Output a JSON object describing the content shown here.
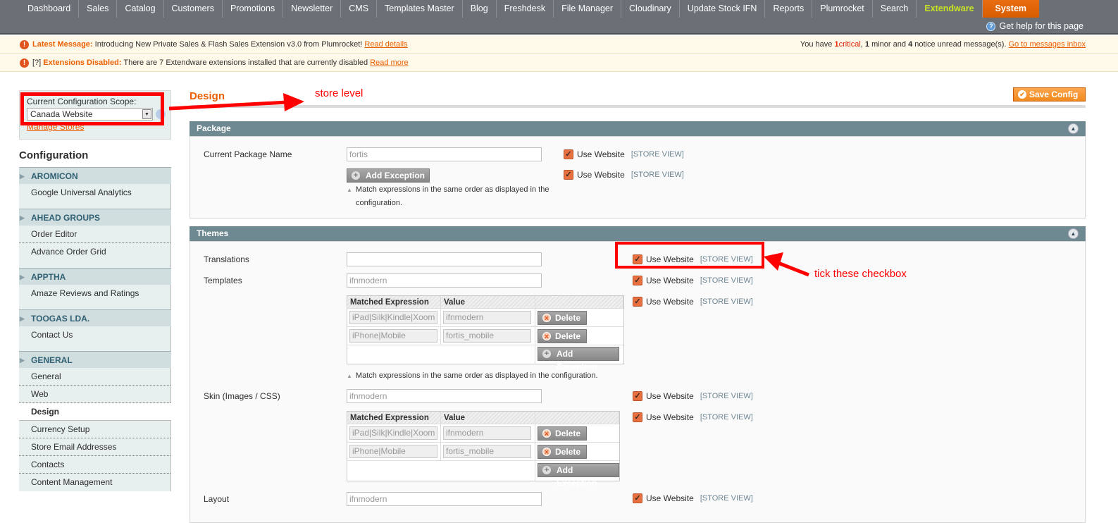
{
  "nav": {
    "items": [
      "Dashboard",
      "Sales",
      "Catalog",
      "Customers",
      "Promotions",
      "Newsletter",
      "CMS",
      "Templates Master",
      "Blog",
      "Freshdesk",
      "File Manager",
      "Cloudinary",
      "Update Stock IFN",
      "Reports",
      "Plumrocket",
      "Search",
      "Extendware",
      "System"
    ],
    "highlight_item": "Extendware",
    "active_item": "System",
    "help_text": "Get help for this page"
  },
  "messages": {
    "latest_label": "Latest Message:",
    "latest_text": "Introducing New Private Sales & Flash Sales Extension v3.0 from Plumrocket!",
    "latest_link": "Read details",
    "summary_prefix": "You have",
    "critical_count": "1",
    "critical_label": "critical",
    "minor_count": "1",
    "minor_label": "minor and",
    "notice_count": "4",
    "notice_label": "notice unread message(s).",
    "inbox_link": "Go to messages inbox",
    "ext_prefix": "[?]",
    "ext_label": "Extensions Disabled:",
    "ext_text": "There are 7 Extendware extensions installed that are currently disabled",
    "ext_link": "Read more"
  },
  "scope": {
    "label": "Current Configuration Scope:",
    "value": "Canada Website",
    "manage_link": "Manage Stores"
  },
  "sidebar": {
    "title": "Configuration",
    "sections": [
      {
        "title": "AROMICON",
        "items": [
          "Google Universal Analytics"
        ]
      },
      {
        "title": "AHEAD GROUPS",
        "items": [
          "Order Editor",
          "Advance Order Grid"
        ]
      },
      {
        "title": "APPTHA",
        "items": [
          "Amaze Reviews and Ratings"
        ]
      },
      {
        "title": "TOOGAS LDA.",
        "items": [
          "Contact Us"
        ]
      },
      {
        "title": "GENERAL",
        "items": [
          "General",
          "Web",
          "Design",
          "Currency Setup",
          "Store Email Addresses",
          "Contacts",
          "Content Management"
        ],
        "active": "Design"
      }
    ]
  },
  "page": {
    "title": "Design",
    "save_label": "Save Config"
  },
  "annotations": {
    "store_level": "store level",
    "tick": "tick these checkbox"
  },
  "package": {
    "title": "Package",
    "current_label": "Current Package Name",
    "current_value": "fortis",
    "add_exception": "Add Exception",
    "note": "Match expressions in the same order as displayed in the",
    "note2": "configuration."
  },
  "common": {
    "use_website": "Use Website",
    "store_view": "[STORE VIEW]",
    "delete": "Delete",
    "add_exception": "Add Exception",
    "col_expr": "Matched Expression",
    "col_value": "Value",
    "note": "Match expressions in the same order as displayed in the configuration."
  },
  "themes": {
    "title": "Themes",
    "translations_label": "Translations",
    "translations_value": "",
    "templates_label": "Templates",
    "templates_value": "ifnmodern",
    "templates_exceptions": [
      {
        "expr": "iPad|Silk|Kindle|Xoom",
        "value": "ifnmodern"
      },
      {
        "expr": "iPhone|Mobile",
        "value": "fortis_mobile"
      }
    ],
    "skin_label": "Skin (Images / CSS)",
    "skin_value": "ifnmodern",
    "skin_exceptions": [
      {
        "expr": "iPad|Silk|Kindle|Xoom",
        "value": "ifnmodern"
      },
      {
        "expr": "iPhone|Mobile",
        "value": "fortis_mobile"
      }
    ],
    "layout_label": "Layout",
    "layout_value": "ifnmodern"
  },
  "colors": {
    "accent": "#eb5e00",
    "header_bar": "#6f8992",
    "annotation": "#ff0000"
  }
}
